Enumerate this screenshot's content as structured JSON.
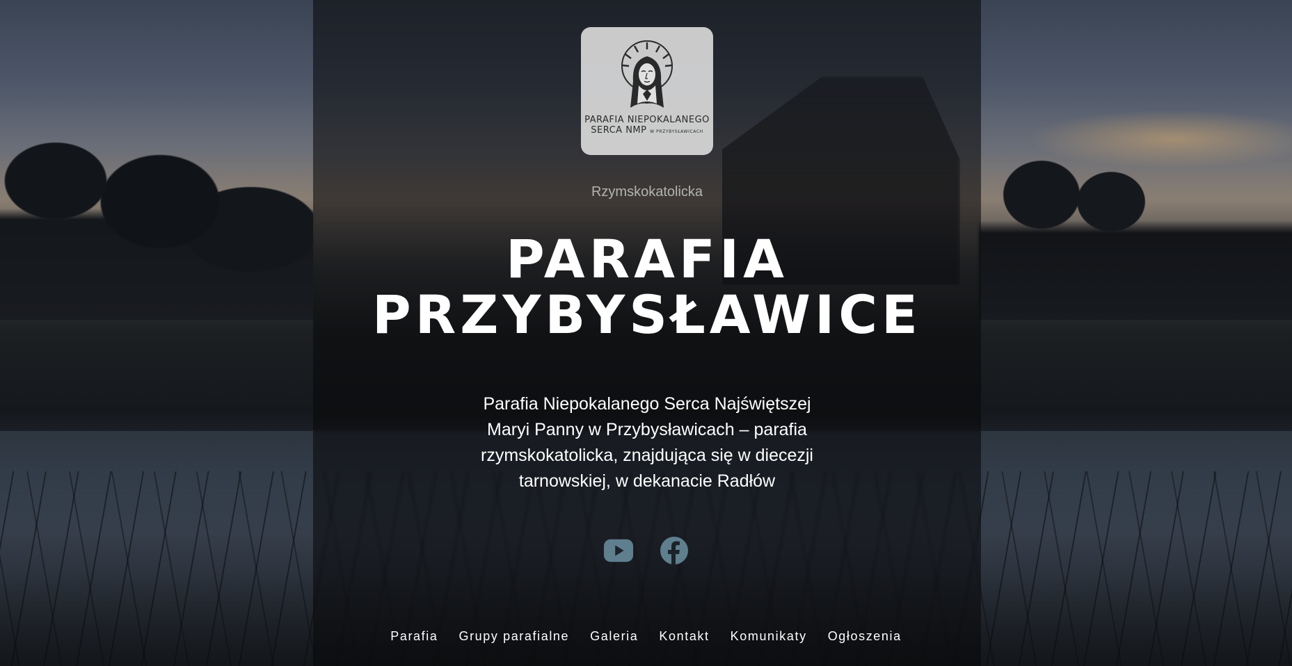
{
  "logo": {
    "line1": "PARAFIA NIEPOKALANEGO",
    "line2": "SERCA NMP",
    "line2_small": "W PRZYBYSŁAWICACH"
  },
  "hero": {
    "eyebrow": "Rzymskokatolicka",
    "title_line1": "PARAFIA",
    "title_line2": "PRZYBYSŁAWICE",
    "description_lines": [
      "Parafia Niepokalanego Serca Najświętszej",
      "Maryi Panny w Przybysławicach – parafia",
      "rzymskokatolicka, znajdująca się w diecezji",
      "tarnowskiej, w dekanacie Radłów"
    ]
  },
  "social": [
    {
      "icon": "youtube-icon",
      "color": "#5f7f8f"
    },
    {
      "icon": "facebook-icon",
      "color": "#5f7f8f"
    }
  ],
  "nav": {
    "items": [
      {
        "label": "Parafia"
      },
      {
        "label": "Grupy parafialne"
      },
      {
        "label": "Galeria"
      },
      {
        "label": "Kontakt"
      },
      {
        "label": "Komunikaty"
      },
      {
        "label": "Ogłoszenia"
      }
    ]
  }
}
